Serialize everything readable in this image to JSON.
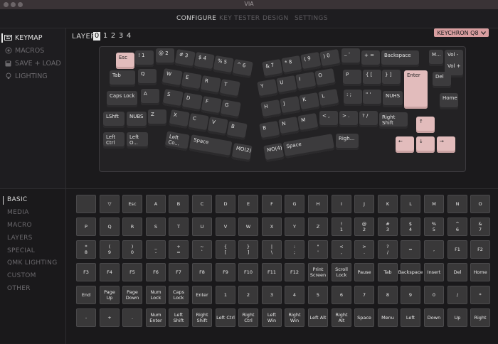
{
  "app": {
    "title": "VIA"
  },
  "nav": {
    "tabs": [
      "CONFIGURE",
      "KEY TESTER",
      "DESIGN",
      "SETTINGS"
    ]
  },
  "menu": {
    "items": [
      "KEYMAP",
      "MACROS",
      "SAVE + LOAD",
      "LIGHTING"
    ]
  },
  "layers": {
    "label": "LAYER",
    "numbers": [
      "0",
      "1",
      "2",
      "3",
      "4"
    ],
    "active": "0"
  },
  "keyboard_select": {
    "label": "KEYCHRON Q8",
    "color": "#d99ea0"
  },
  "keyboard": {
    "row0": [
      "Esc",
      "!\n1",
      "@\n2",
      "#\n3",
      "$\n4",
      "%\n5",
      "^\n6",
      "&\n7",
      "*\n8",
      "(\n9",
      ")\n0",
      "_\n-",
      "+\n=",
      "Backspace",
      "M...",
      "Vol -"
    ],
    "row1": [
      "Tab",
      "Q",
      "W",
      "E",
      "R",
      "T",
      "Y",
      "U",
      "I",
      "O",
      "P",
      "{\n[",
      "}\n]",
      "Enter",
      "Del",
      "Vol +"
    ],
    "row2": [
      "Caps Lock",
      "A",
      "S",
      "D",
      "F",
      "G",
      "H",
      "J",
      "K",
      "L",
      ":\n;",
      "\"\n'",
      "NUHS",
      "Home"
    ],
    "row3": [
      "LShft",
      "NUBS",
      "Z",
      "X",
      "C",
      "V",
      "B",
      "B",
      "N",
      "M",
      "<\n,",
      ">\n.",
      "?\n/",
      "Right Shift",
      "↑"
    ],
    "row4": [
      "Left Ctrl",
      "Left O...",
      "Left Co...",
      "Space",
      "MO(2)",
      "MO(4)",
      "Space",
      "Righ...",
      "←",
      "↓",
      "→"
    ]
  },
  "categories": {
    "items": [
      "BASIC",
      "MEDIA",
      "MACRO",
      "LAYERS",
      "SPECIAL",
      "QMK LIGHTING",
      "CUSTOM",
      "OTHER"
    ]
  },
  "keycodes": {
    "rows": [
      [
        "",
        "▽",
        "Esc",
        "A",
        "B",
        "C",
        "D",
        "E",
        "F",
        "G",
        "H",
        "I",
        "J",
        "K",
        "L",
        "M",
        "N",
        "O"
      ],
      [
        "P",
        "Q",
        "R",
        "S",
        "T",
        "U",
        "V",
        "W",
        "X",
        "Y",
        "Z",
        "!\n1",
        "@\n2",
        "#\n3",
        "$\n4",
        "%\n5",
        "^\n6",
        "&\n7"
      ],
      [
        "*\n8",
        "(\n9",
        ")\n0",
        "_\n-",
        "+\n=",
        "~\n`",
        "{\n[",
        "}\n]",
        "|\n\\",
        ":\n;",
        "\"\n'",
        "<\n,",
        ">\n.",
        "?\n/",
        "=",
        ",",
        "F1",
        "F2"
      ],
      [
        "F3",
        "F4",
        "F5",
        "F6",
        "F7",
        "F8",
        "F9",
        "F10",
        "F11",
        "F12",
        "Print\nScreen",
        "Scroll\nLock",
        "Pause",
        "Tab",
        "Backspace",
        "Insert",
        "Del",
        "Home"
      ],
      [
        "End",
        "Page Up",
        "Page\nDown",
        "Num\nLock",
        "Caps\nLock",
        "Enter",
        "1",
        "2",
        "3",
        "4",
        "5",
        "6",
        "7",
        "8",
        "9",
        "0",
        "/",
        "*"
      ],
      [
        "-",
        "+",
        ".",
        "Num\nEnter",
        "Left\nShift",
        "Right\nShift",
        "Left Ctrl",
        "Right\nCtrl",
        "Left Win",
        "Right\nWin",
        "Left Alt",
        "Right Alt",
        "Space",
        "Menu",
        "Left",
        "Down",
        "Up",
        "Right"
      ]
    ]
  }
}
